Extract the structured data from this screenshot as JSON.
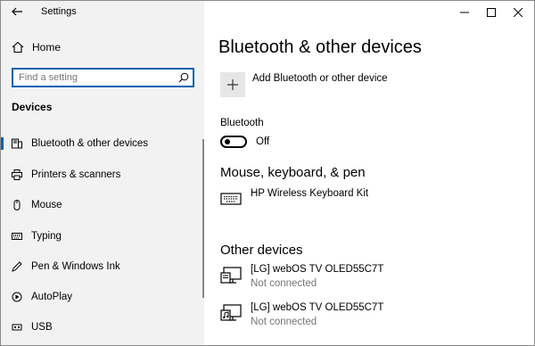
{
  "window": {
    "title": "Settings"
  },
  "sidebar": {
    "home_label": "Home",
    "search_placeholder": "Find a setting",
    "section_title": "Devices",
    "items": [
      {
        "label": "Bluetooth & other devices",
        "icon": "bluetooth-devices-icon",
        "selected": true
      },
      {
        "label": "Printers & scanners",
        "icon": "printer-icon",
        "selected": false
      },
      {
        "label": "Mouse",
        "icon": "mouse-icon",
        "selected": false
      },
      {
        "label": "Typing",
        "icon": "keyboard-icon",
        "selected": false
      },
      {
        "label": "Pen & Windows Ink",
        "icon": "pen-icon",
        "selected": false
      },
      {
        "label": "AutoPlay",
        "icon": "autoplay-icon",
        "selected": false
      },
      {
        "label": "USB",
        "icon": "usb-icon",
        "selected": false
      }
    ]
  },
  "main": {
    "title": "Bluetooth & other devices",
    "add_device_label": "Add Bluetooth or other device",
    "bluetooth": {
      "label": "Bluetooth",
      "state": "Off"
    },
    "mouse_section": {
      "title": "Mouse, keyboard, & pen",
      "devices": [
        {
          "name": "HP Wireless Keyboard Kit",
          "icon": "keyboard-icon"
        }
      ]
    },
    "other_section": {
      "title": "Other devices",
      "devices": [
        {
          "name": "[LG] webOS TV OLED55C7T",
          "status": "Not connected",
          "icon": "tv-display-icon"
        },
        {
          "name": "[LG] webOS TV OLED55C7T",
          "status": "Not connected",
          "icon": "tv-media-icon"
        }
      ]
    }
  },
  "colors": {
    "accent": "#0063b1",
    "sidebar_bg": "#f2f2f2",
    "secondary_text": "#767676"
  }
}
